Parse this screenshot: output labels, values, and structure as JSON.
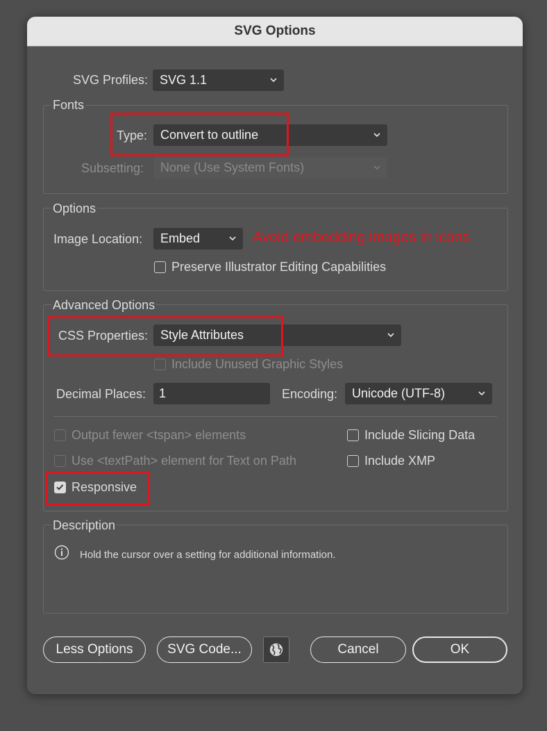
{
  "window": {
    "title": "SVG Options"
  },
  "svg_profiles": {
    "label": "SVG Profiles:",
    "value": "SVG 1.1"
  },
  "fonts": {
    "title": "Fonts",
    "type_label": "Type:",
    "type_value": "Convert to outline",
    "subsetting_label": "Subsetting:",
    "subsetting_value": "None (Use System Fonts)"
  },
  "options": {
    "title": "Options",
    "image_location_label": "Image Location:",
    "image_location_value": "Embed",
    "annotation": "Avoid embedding images in icons",
    "preserve_label": "Preserve Illustrator Editing Capabilities"
  },
  "advanced": {
    "title": "Advanced Options",
    "css_label": "CSS Properties:",
    "css_value": "Style Attributes",
    "unused_styles_label": "Include Unused Graphic Styles",
    "decimal_label": "Decimal Places:",
    "decimal_value": "1",
    "encoding_label": "Encoding:",
    "encoding_value": "Unicode (UTF-8)",
    "fewer_tspan_label": "Output fewer <tspan> elements",
    "textpath_label": "Use <textPath> element for Text on Path",
    "responsive_label": "Responsive",
    "slicing_label": "Include Slicing Data",
    "xmp_label": "Include XMP"
  },
  "description": {
    "title": "Description",
    "text": "Hold the cursor over a setting for additional information."
  },
  "buttons": {
    "less_options": "Less Options",
    "svg_code": "SVG Code...",
    "cancel": "Cancel",
    "ok": "OK"
  },
  "colors": {
    "highlight": "#e0141e",
    "annotation_text": "#e0141e"
  },
  "icons": [
    "chevron-down-icon",
    "info-icon",
    "globe-icon",
    "checkmark-icon"
  ]
}
